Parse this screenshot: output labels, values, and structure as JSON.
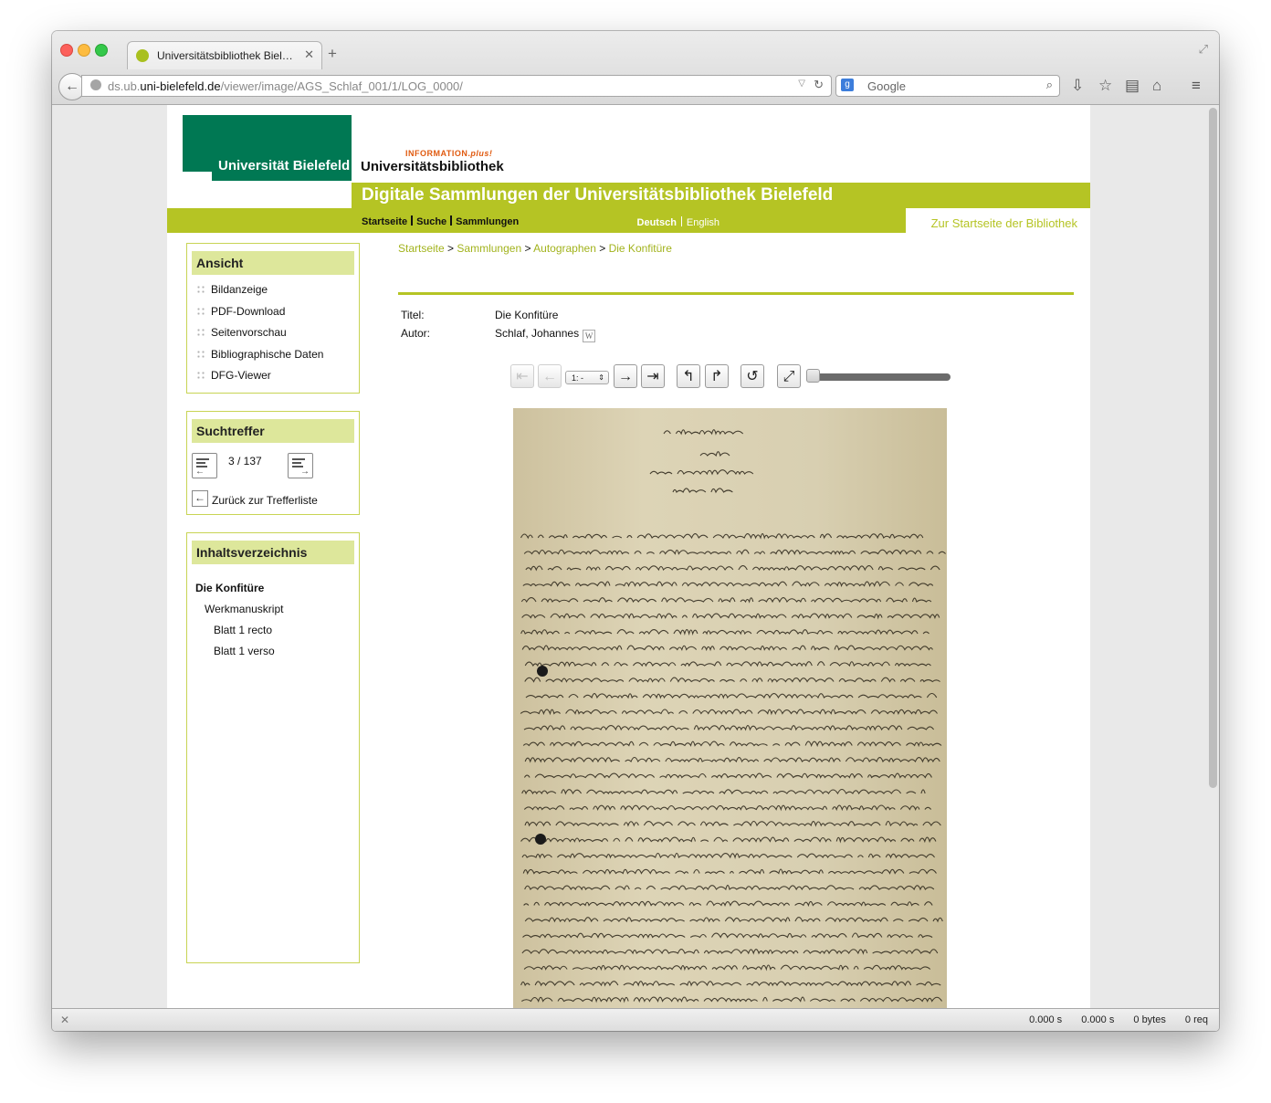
{
  "browser": {
    "tab_title": "Universitätsbibliothek Biel…",
    "url_prefix": "ds.ub.",
    "url_domain": "uni-bielefeld.de",
    "url_path": "/viewer/image/AGS_Schlaf_001/1/LOG_0000/",
    "search_placeholder": "Google",
    "search_engine_glyph": "g"
  },
  "header": {
    "logo_text": "Universität Bielefeld",
    "info_plus": "INFORMATION.",
    "info_plus_suffix": "plus!",
    "library_name": "Universitätsbibliothek",
    "banner_title": "Digitale Sammlungen der Universitätsbibliothek Bielefeld",
    "nav": [
      "Startseite",
      "Suche",
      "Sammlungen"
    ],
    "lang_de": "Deutsch",
    "lang_en": "English",
    "library_home": "Zur Startseite der Bibliothek"
  },
  "sidebar": {
    "view": {
      "title": "Ansicht",
      "items": [
        "Bildanzeige",
        "PDF-Download",
        "Seitenvorschau",
        "Bibliographische Daten",
        "DFG-Viewer"
      ]
    },
    "hits": {
      "title": "Suchtreffer",
      "count": "3 / 137",
      "back_label": "Zurück zur Trefferliste"
    },
    "toc": {
      "title": "Inhaltsverzeichnis",
      "items": [
        "Die Konfitüre",
        "Werkmanuskript",
        "Blatt 1 recto",
        "Blatt 1 verso"
      ]
    }
  },
  "breadcrumb": {
    "items": [
      "Startseite",
      "Sammlungen",
      "Autographen",
      "Die Konfitüre"
    ],
    "separator": ">"
  },
  "metadata": {
    "title_label": "Titel:",
    "title_value": "Die Konfitüre",
    "author_label": "Autor:",
    "author_value": "Schlaf, Johannes",
    "wiki_glyph": "W"
  },
  "viewer": {
    "page_select_value": "1: -",
    "zoom_fraction": 0.0
  },
  "statusbar": {
    "time1": "0.000 s",
    "time2": "0.000 s",
    "bytes": "0 bytes",
    "requests": "0 req"
  }
}
